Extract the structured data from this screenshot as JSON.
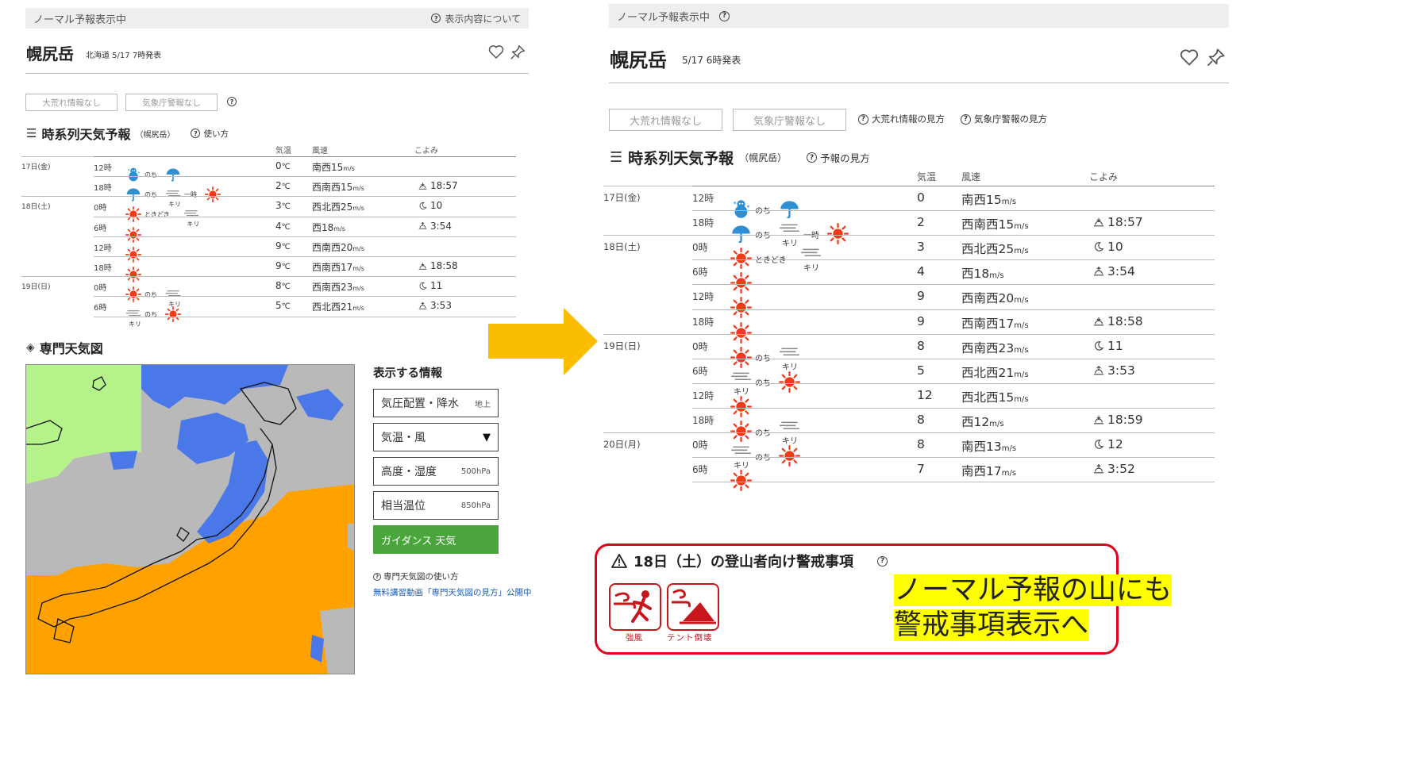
{
  "left": {
    "banner": "ノーマル予報表示中",
    "about_link": "表示内容について",
    "mountain": "幌尻岳",
    "issued": "北海道 5/17 7時発表",
    "badges": [
      "大荒れ情報なし",
      "気象庁警報なし"
    ],
    "section_title": "時系列天気予報",
    "section_sub": "（幌尻岳）",
    "usage": "使い方",
    "headers": {
      "temp": "気温",
      "wind": "風速",
      "almanac": "こよみ"
    },
    "days": [
      {
        "label": "17日(金)",
        "row": 0
      },
      {
        "label": "18日(土)",
        "row": 2
      },
      {
        "label": "19日(日)",
        "row": 6
      }
    ],
    "rows": [
      {
        "time": "12時",
        "temp": "0",
        "dir": "南西",
        "speed": "15",
        "alm_icon": "",
        "alm": ""
      },
      {
        "time": "18時",
        "temp": "2",
        "dir": "西南西",
        "speed": "15",
        "alm_icon": "sunset",
        "alm": "18:57"
      },
      {
        "time": "0時",
        "temp": "3",
        "dir": "西北西",
        "speed": "25",
        "alm_icon": "moon",
        "alm": "10"
      },
      {
        "time": "6時",
        "temp": "4",
        "dir": "西",
        "speed": "18",
        "alm_icon": "sunrise",
        "alm": "3:54"
      },
      {
        "time": "12時",
        "temp": "9",
        "dir": "西南西",
        "speed": "20",
        "alm_icon": "",
        "alm": ""
      },
      {
        "time": "18時",
        "temp": "9",
        "dir": "西南西",
        "speed": "17",
        "alm_icon": "sunset",
        "alm": "18:58"
      },
      {
        "time": "0時",
        "temp": "8",
        "dir": "西南西",
        "speed": "23",
        "alm_icon": "moon",
        "alm": "11"
      },
      {
        "time": "6時",
        "temp": "5",
        "dir": "西北西",
        "speed": "21",
        "alm_icon": "sunrise",
        "alm": "3:53"
      }
    ],
    "weather": [
      [
        [
          "snowman"
        ],
        [
          "umbrella"
        ]
      ],
      [
        [
          "umbrella"
        ],
        [
          "fog"
        ],
        [
          "sun"
        ]
      ],
      [
        [
          "sun"
        ],
        [
          "fog"
        ]
      ],
      [
        [
          "sun"
        ]
      ],
      [
        [
          "sun"
        ]
      ],
      [
        [
          "sun"
        ]
      ],
      [
        [
          "sun"
        ],
        [
          "fog"
        ]
      ],
      [
        [
          "fog"
        ],
        [
          "sun"
        ]
      ]
    ],
    "connectors": {
      "nochi": "のち",
      "ichiji": "一時",
      "tokidoki": "ときどき"
    },
    "fog_label": "キリ",
    "temp_unit": "℃",
    "wind_unit": "m/s",
    "expert_title": "専門天気図",
    "info_title": "表示する情報",
    "layers": [
      {
        "label": "気圧配置・降水",
        "tag": "地上",
        "active": false
      },
      {
        "label": "気温・風",
        "tag": "▼",
        "active": false
      },
      {
        "label": "高度・湿度",
        "tag": "500hPa",
        "active": false
      },
      {
        "label": "相当温位",
        "tag": "850hPa",
        "active": false
      },
      {
        "label": "ガイダンス 天気",
        "tag": "",
        "active": true
      }
    ],
    "usage_link": "専門天気図の使い方",
    "video_link": "無料講習動画「専門天気図の見方」公開中"
  },
  "right": {
    "banner": "ノーマル予報表示中",
    "mountain": "幌尻岳",
    "issued": "5/17 6時発表",
    "badges": [
      "大荒れ情報なし",
      "気象庁警報なし"
    ],
    "badge_links": [
      "大荒れ情報の見方",
      "気象庁警報の見方"
    ],
    "section_title": "時系列天気予報",
    "section_sub": "（幌尻岳）",
    "usage": "予報の見方",
    "headers": {
      "temp": "気温",
      "wind": "風速",
      "almanac": "こよみ"
    },
    "days": [
      {
        "label": "17日(金)",
        "row": 0
      },
      {
        "label": "18日(土)",
        "row": 2
      },
      {
        "label": "19日(日)",
        "row": 6
      },
      {
        "label": "20日(月)",
        "row": 10
      }
    ],
    "rows": [
      {
        "time": "12時",
        "temp": "0",
        "dir": "南西",
        "speed": "15",
        "alm_icon": "",
        "alm": ""
      },
      {
        "time": "18時",
        "temp": "2",
        "dir": "西南西",
        "speed": "15",
        "alm_icon": "sunset",
        "alm": "18:57"
      },
      {
        "time": "0時",
        "temp": "3",
        "dir": "西北西",
        "speed": "25",
        "alm_icon": "moon",
        "alm": "10"
      },
      {
        "time": "6時",
        "temp": "4",
        "dir": "西",
        "speed": "18",
        "alm_icon": "sunrise",
        "alm": "3:54"
      },
      {
        "time": "12時",
        "temp": "9",
        "dir": "西南西",
        "speed": "20",
        "alm_icon": "",
        "alm": ""
      },
      {
        "time": "18時",
        "temp": "9",
        "dir": "西南西",
        "speed": "17",
        "alm_icon": "sunset",
        "alm": "18:58"
      },
      {
        "time": "0時",
        "temp": "8",
        "dir": "西南西",
        "speed": "23",
        "alm_icon": "moon",
        "alm": "11"
      },
      {
        "time": "6時",
        "temp": "5",
        "dir": "西北西",
        "speed": "21",
        "alm_icon": "sunrise",
        "alm": "3:53"
      },
      {
        "time": "12時",
        "temp": "12",
        "dir": "西北西",
        "speed": "15",
        "alm_icon": "",
        "alm": ""
      },
      {
        "time": "18時",
        "temp": "8",
        "dir": "西",
        "speed": "12",
        "alm_icon": "sunset",
        "alm": "18:59"
      },
      {
        "time": "0時",
        "temp": "8",
        "dir": "南西",
        "speed": "13",
        "alm_icon": "moon",
        "alm": "12"
      },
      {
        "time": "6時",
        "temp": "7",
        "dir": "南西",
        "speed": "17",
        "alm_icon": "sunrise",
        "alm": "3:52"
      }
    ],
    "weather": [
      [
        [
          "snowman"
        ],
        [
          "umbrella"
        ]
      ],
      [
        [
          "umbrella"
        ],
        [
          "fog"
        ],
        [
          "sun"
        ]
      ],
      [
        [
          "sun"
        ],
        [
          "fog"
        ]
      ],
      [
        [
          "sun"
        ]
      ],
      [
        [
          "sun"
        ]
      ],
      [
        [
          "sun"
        ]
      ],
      [
        [
          "sun"
        ],
        [
          "fog"
        ]
      ],
      [
        [
          "fog"
        ],
        [
          "sun"
        ]
      ],
      [
        [
          "sun"
        ]
      ],
      [
        [
          "sun"
        ],
        [
          "fog"
        ]
      ],
      [
        [
          "fog"
        ],
        [
          "sun"
        ]
      ],
      [
        [
          "sun"
        ]
      ]
    ],
    "alert_title": "18日（土）の登山者向け警戒事項",
    "alert_icons": [
      {
        "label": "強風",
        "icon": "strong-wind"
      },
      {
        "label": "テント倒壊",
        "icon": "tent-collapse"
      }
    ],
    "callout_lines": [
      "ノーマル予報の山にも",
      "警戒事項表示へ"
    ]
  },
  "colors": {
    "arrow": "#fbbd00",
    "sun": "#f23a17",
    "umbrella": "#2f8fd3",
    "alert_red": "#e0001b",
    "sea_orange": "#ffa200",
    "precip_blue": "#4a78e8",
    "cloud_gray": "#b9b9b9",
    "green_area": "#b6f28a",
    "active_layer": "#4aa63c"
  }
}
